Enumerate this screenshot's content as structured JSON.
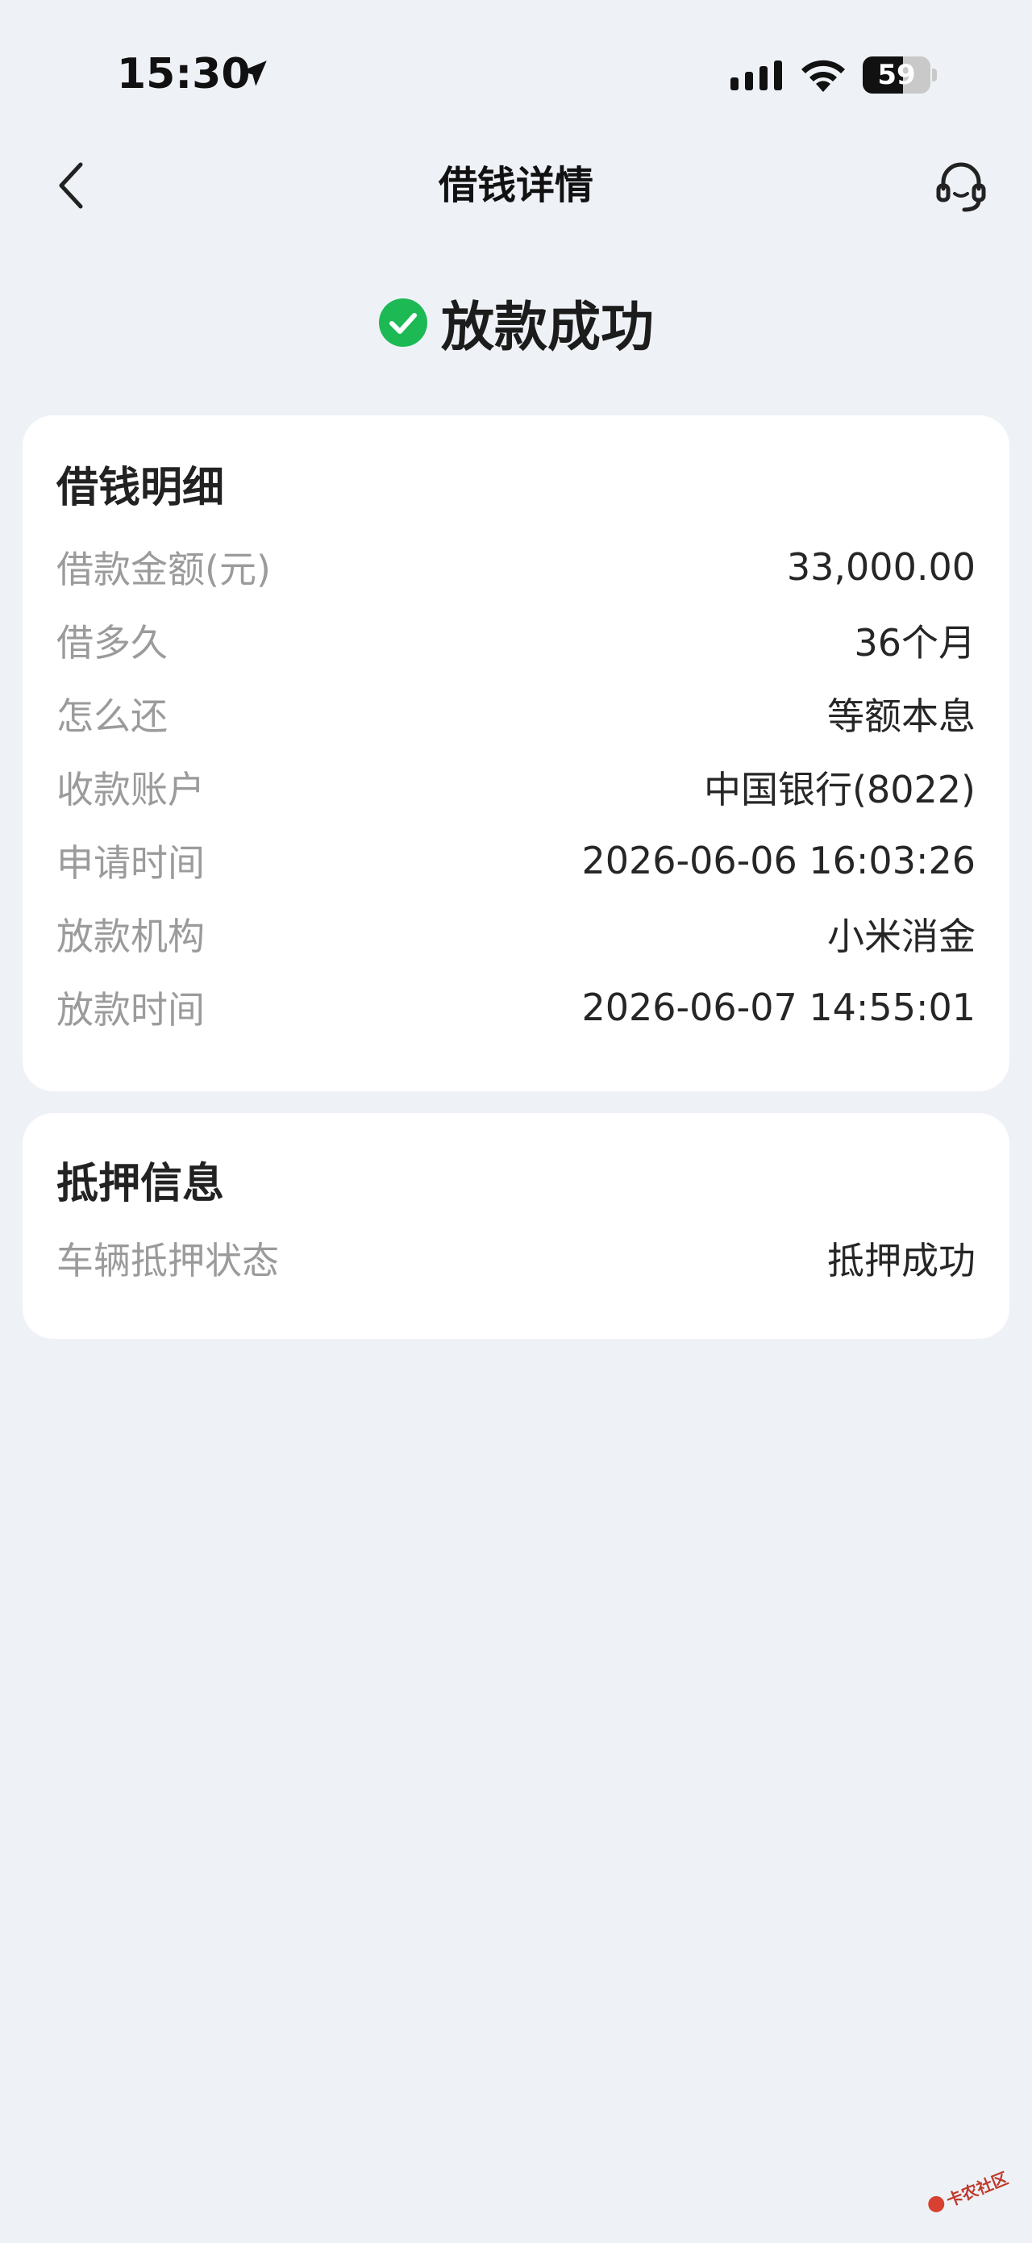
{
  "status_bar": {
    "time": "15:30",
    "battery_level": "59",
    "battery_fraction": 0.59
  },
  "nav": {
    "title": "借钱详情",
    "back_icon": "chevron-left-icon",
    "support_icon": "headset-icon"
  },
  "result": {
    "icon": "check-circle-icon",
    "icon_color": "#1db954",
    "text": "放款成功"
  },
  "loan_details": {
    "title": "借钱明细",
    "rows": [
      {
        "label": "借款金额(元)",
        "value": "33,000.00"
      },
      {
        "label": "借多久",
        "value": "36个月"
      },
      {
        "label": "怎么还",
        "value": "等额本息"
      },
      {
        "label": "收款账户",
        "value": "中国银行(8022)"
      },
      {
        "label": "申请时间",
        "value": "2026-06-06 16:03:26"
      },
      {
        "label": "放款机构",
        "value": "小米消金"
      },
      {
        "label": "放款时间",
        "value": "2026-06-07 14:55:01"
      }
    ]
  },
  "pledge_info": {
    "title": "抵押信息",
    "rows": [
      {
        "label": "车辆抵押状态",
        "value": "抵押成功"
      }
    ]
  },
  "watermark": {
    "text": "卡农社区"
  }
}
